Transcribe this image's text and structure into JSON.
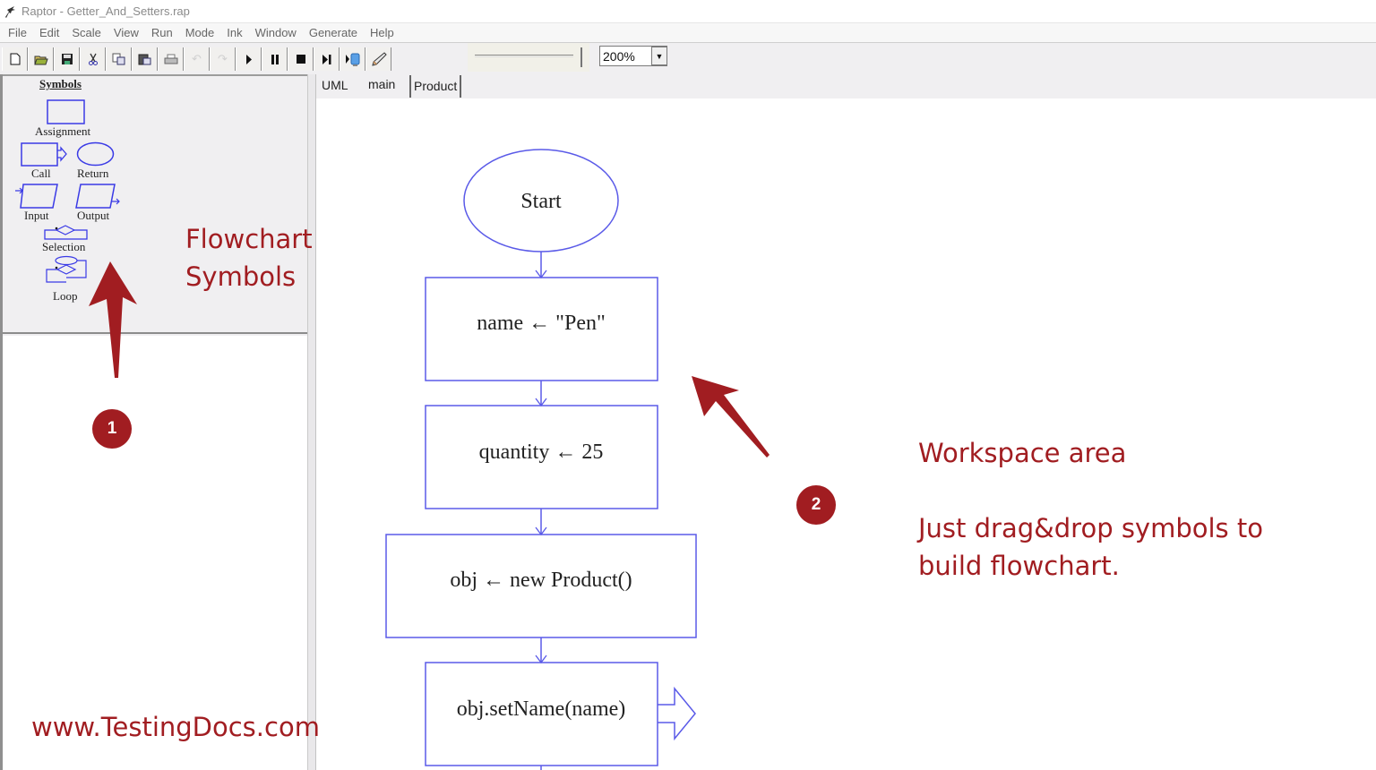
{
  "window": {
    "title": "Raptor - Getter_And_Setters.rap",
    "app_icon": "raptor-logo-icon"
  },
  "menu": [
    "File",
    "Edit",
    "Scale",
    "View",
    "Run",
    "Mode",
    "Ink",
    "Window",
    "Generate",
    "Help"
  ],
  "toolbar": {
    "buttons": [
      {
        "name": "new",
        "icon": "new-file-icon",
        "enabled": true
      },
      {
        "name": "open",
        "icon": "open-folder-icon",
        "enabled": true
      },
      {
        "name": "save",
        "icon": "save-icon",
        "enabled": true
      },
      {
        "name": "cut",
        "icon": "scissors-icon",
        "enabled": true
      },
      {
        "name": "copy",
        "icon": "copy-icon",
        "enabled": true
      },
      {
        "name": "paste",
        "icon": "paste-icon",
        "enabled": true
      },
      {
        "name": "print",
        "icon": "printer-icon",
        "enabled": true
      },
      {
        "name": "undo",
        "icon": "undo-icon",
        "enabled": false
      },
      {
        "name": "redo",
        "icon": "redo-icon",
        "enabled": false
      },
      {
        "name": "run",
        "icon": "play-icon",
        "enabled": true
      },
      {
        "name": "pause",
        "icon": "pause-icon",
        "enabled": true
      },
      {
        "name": "stop",
        "icon": "stop-icon",
        "enabled": true
      },
      {
        "name": "step",
        "icon": "step-icon",
        "enabled": true
      },
      {
        "name": "test-server",
        "icon": "server-icon",
        "enabled": true
      },
      {
        "name": "pen",
        "icon": "pen-icon",
        "enabled": true
      }
    ],
    "speed_slider_value": 1.0,
    "zoom_value": "200%"
  },
  "symbols_panel": {
    "title": "Symbols",
    "items": [
      "Assignment",
      "Call",
      "Return",
      "Input",
      "Output",
      "Selection",
      "Loop"
    ]
  },
  "tabs": [
    {
      "label": "UML",
      "active": false
    },
    {
      "label": "main",
      "active": false
    },
    {
      "label": "Product",
      "active": true
    }
  ],
  "flowchart": {
    "start_label": "Start",
    "steps": [
      {
        "type": "assignment",
        "text": "name ← \"Pen\""
      },
      {
        "type": "assignment",
        "text": "quantity ← 25"
      },
      {
        "type": "assignment",
        "text": "obj ← new Product()"
      },
      {
        "type": "call",
        "text": "obj.setName(name)"
      }
    ]
  },
  "annotations": {
    "flowchart_symbols_line1": "Flowchart",
    "flowchart_symbols_line2": "Symbols",
    "badge1": "1",
    "badge2": "2",
    "workspace_title": "Workspace area",
    "workspace_line1": "Just drag&drop symbols to",
    "workspace_line2": "build flowchart.",
    "watermark": "www.TestingDocs.com",
    "accent_color": "#a11d21"
  },
  "colors": {
    "symbol_stroke": "#4a4ae0",
    "annotation": "#a11d21"
  }
}
